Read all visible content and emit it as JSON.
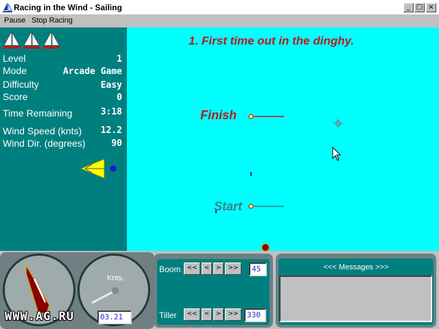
{
  "window": {
    "title": "Racing in the Wind - Sailing",
    "min_glyph": "_",
    "max_glyph": "□",
    "close_glyph": "×"
  },
  "menu": {
    "items": [
      {
        "label": "Pause"
      },
      {
        "label": "Stop Racing"
      }
    ]
  },
  "stats": {
    "level": {
      "label": "Level",
      "value": "1"
    },
    "mode": {
      "label": "Mode",
      "value": "Arcade Game"
    },
    "difficulty": {
      "label": "Difficulty",
      "value": "Easy"
    },
    "score": {
      "label": "Score",
      "value": "0"
    },
    "time": {
      "label": "Time Remaining",
      "value": "3:18"
    },
    "wind_speed": {
      "label": "Wind Speed (knts)",
      "value": "12.2"
    },
    "wind_dir": {
      "label": "Wind Dir. (degrees)",
      "value": "90"
    }
  },
  "lives_remaining": 3,
  "course": {
    "heading": "1. First time out in the dinghy.",
    "finish_label": "Finish",
    "start_label": "Start"
  },
  "speed_gauge": {
    "label": "Knts.",
    "value": "03.21"
  },
  "controls": {
    "boom": {
      "label": "Boom",
      "btn_far_left": "<<",
      "btn_left": "<",
      "btn_right": ">",
      "btn_far_right": ">>",
      "value": "45"
    },
    "tiller": {
      "label": "Tiller",
      "btn_far_left": "<<",
      "btn_left": "<",
      "btn_right": ">",
      "btn_far_right": ">>",
      "value": "330"
    }
  },
  "messages": {
    "title": "<<< Messages >>>",
    "body": ""
  },
  "watermark": "WWW.AG.RU",
  "colors": {
    "panel_teal": "#007f7f",
    "water": "#00ffff",
    "heading_red": "#b71c1c",
    "start_teal": "#3b7f8a",
    "value_blue": "#2a2ad0"
  }
}
